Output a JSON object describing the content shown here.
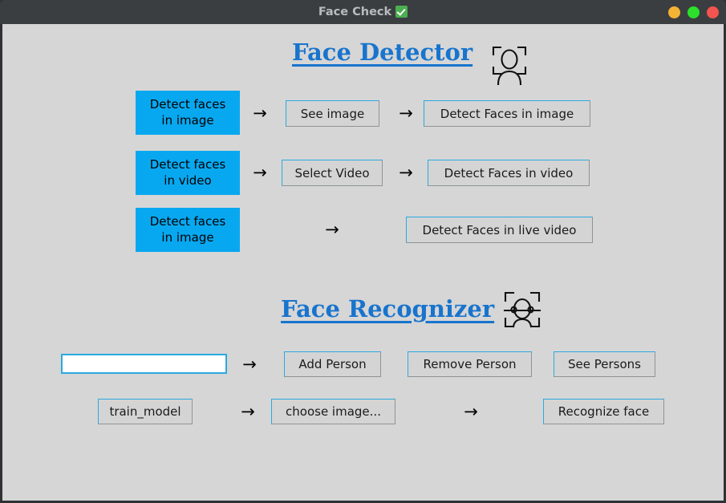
{
  "window": {
    "title": "Face Check",
    "title_icon": "check-mark-emoji",
    "controls": [
      {
        "name": "minimize-button",
        "color": "#f5b335"
      },
      {
        "name": "maximize-button",
        "color": "#2ce02c"
      },
      {
        "name": "close-button",
        "color": "#f2554f"
      }
    ],
    "background": "#d6d6d6",
    "titlebar_background": "#3b3e40"
  },
  "detector": {
    "heading": "Face Detector",
    "heading_color": "#1874cd",
    "icon": "face-detect-person-icon",
    "rows": [
      {
        "chip": "Detect faces\nin image",
        "chip_line1": "Detect faces",
        "chip_line2": "in image",
        "arrow1": "→",
        "button1": "See image",
        "arrow2": "→",
        "button2": "Detect Faces in image"
      },
      {
        "chip_line1": "Detect faces",
        "chip_line2": "in video",
        "arrow1": "→",
        "button1": "Select Video",
        "arrow2": "→",
        "button2": "Detect Faces in video"
      },
      {
        "chip_line1": "Detect faces",
        "chip_line2": "in image",
        "arrow1": "→",
        "button1": "Detect Faces in live video"
      }
    ]
  },
  "recognizer": {
    "heading": "Face Recognizer",
    "heading_color": "#1874cd",
    "icon": "face-scan-icon",
    "person_row": {
      "name_input_value": "",
      "name_input_placeholder": "",
      "arrow": "→",
      "add_button": "Add Person",
      "remove_button": "Remove Person",
      "see_button": "See Persons"
    },
    "train_row": {
      "train_button": "train_model",
      "arrow1": "→",
      "choose_button": "choose image...",
      "arrow2": "→",
      "recognize_button": "Recognize face"
    }
  },
  "theme": {
    "chip_color": "#08a8f0",
    "button_face": "#d4d4d4",
    "button_border": "#2ba9e0",
    "text_color": "#1a1a1a"
  }
}
